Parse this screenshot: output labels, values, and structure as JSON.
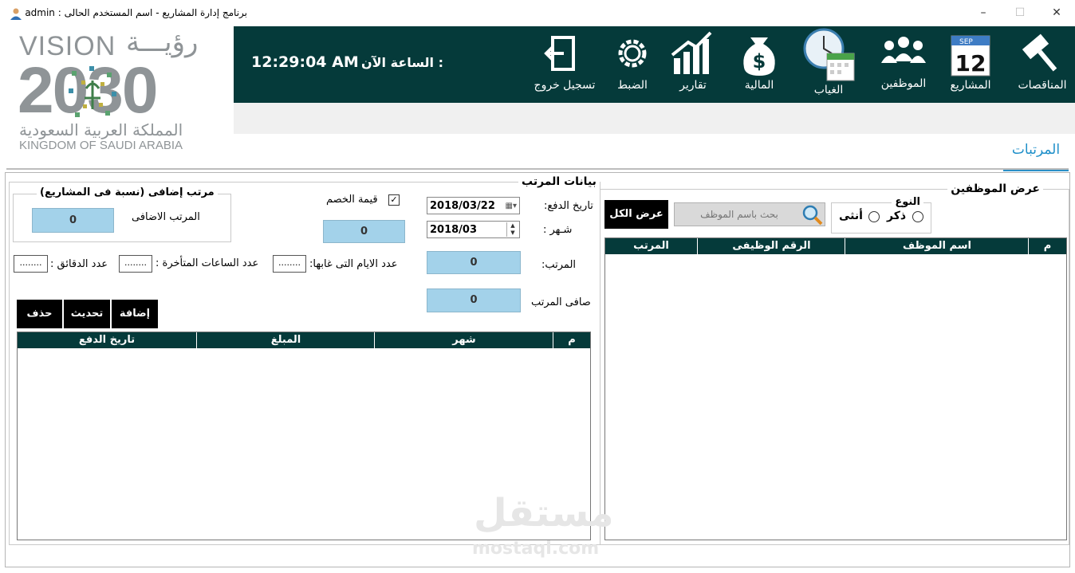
{
  "titlebar": {
    "title": "برنامج إدارة المشاريع  -  اسم المستخدم الحالى  :  admin",
    "minimize": "–",
    "maximize": "☐",
    "close": "✕"
  },
  "logo": {
    "vision": "VISION",
    "ruya": "رؤيـــة",
    "year": "2030",
    "kingdom_ar": "المملكة العربية السعودية",
    "kingdom_en": "KINGDOM OF SAUDI ARABIA"
  },
  "nav": [
    {
      "label": "المناقصات",
      "icon": "gavel-icon"
    },
    {
      "label": "المشاريع",
      "icon": "calendar-icon"
    },
    {
      "label": "الموظفين",
      "icon": "users-icon"
    },
    {
      "label": "الغياب",
      "icon": "clock-calendar-icon"
    },
    {
      "label": "المالية",
      "icon": "money-bag-icon"
    },
    {
      "label": "تقارير",
      "icon": "chart-icon"
    },
    {
      "label": "الضبط",
      "icon": "gear-icon"
    },
    {
      "label": "تسجيل خروج",
      "icon": "logout-icon"
    }
  ],
  "calendar_icon": {
    "month": "SEP",
    "day": "12"
  },
  "clock": {
    "label": "الساعة الآن :",
    "time": "12:29:04 AM"
  },
  "tab": {
    "label": "المرتبات"
  },
  "employees": {
    "title": "عرض الموظفين",
    "type_title": "النوع",
    "male": "ذكر",
    "female": "أنثى",
    "search_placeholder": "بحث باسم الموظف",
    "show_all": "عرض الكل",
    "columns": [
      "م",
      "اسم الموظف",
      "الرقم الوظيفى",
      "المرتب"
    ]
  },
  "salary": {
    "title": "بيانات المرتب",
    "pay_date_label": "تاريخ الدفع:",
    "pay_date": "2018/03/22",
    "month_label": "شـهر :",
    "month": "2018/03",
    "salary_label": "المرتب:",
    "salary_value": "0",
    "net_label": "صافى المرتب",
    "net_value": "0",
    "deduction_label": "قيمة الخصم",
    "deduction_value": "0",
    "extra_title": "مرتب إضافى  (نسبة فى المشاريع)",
    "extra_label": "المرتب الاضافى",
    "extra_value": "0",
    "absent_label": "عدد الايام التى غابها:",
    "absent_value": "........",
    "late_hours_label": "عدد الساعات المتأخرة :",
    "late_hours_value": "........",
    "minutes_label": "عدد الدقائق :",
    "minutes_value": "........",
    "add": "إضافة",
    "update": "تحديث",
    "delete": "حذف",
    "columns": [
      "م",
      "شهر",
      "المبلغ",
      "تاريخ الدفع"
    ]
  },
  "watermark": {
    "ar": "مستقل",
    "en": "mostaql.com"
  }
}
